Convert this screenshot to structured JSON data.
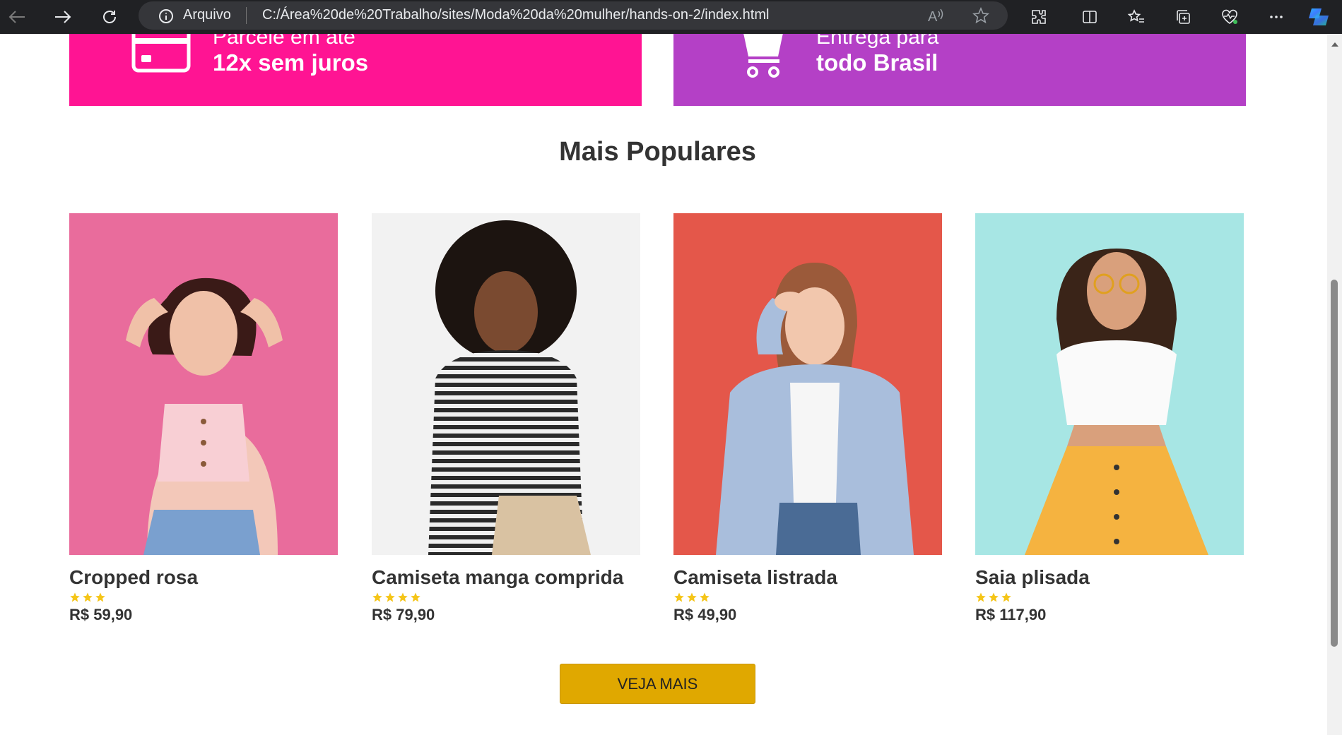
{
  "browser": {
    "site_label": "Arquivo",
    "url": "C:/Área%20de%20Trabalho/sites/Moda%20da%20mulher/hands-on-2/index.html",
    "read_aloud_label": "A"
  },
  "banners": [
    {
      "line1": "Parcele em até",
      "line2": "12x sem juros",
      "icon": "credit-card-icon",
      "color": "#ff1493"
    },
    {
      "line1": "Entrega para",
      "line2": "todo Brasil",
      "icon": "shopping-cart-icon",
      "color": "#b440c6"
    }
  ],
  "section": {
    "title": "Mais Populares"
  },
  "products": [
    {
      "name": "Cropped rosa",
      "rating": 3,
      "price": "R$ 59,90",
      "bg": "#e86a9a",
      "icon": "product-photo-pink-top"
    },
    {
      "name": "Camiseta manga comprida",
      "rating": 4,
      "price": "R$ 79,90",
      "bg": "#f1f1f1",
      "icon": "product-photo-striped-longsleeve"
    },
    {
      "name": "Camiseta listrada",
      "rating": 3,
      "price": "R$ 49,90",
      "bg": "#e35848",
      "icon": "product-photo-blue-shirt"
    },
    {
      "name": "Saia plisada",
      "rating": 3,
      "price": "R$ 117,90",
      "bg": "#a8e7e6",
      "icon": "product-photo-yellow-skirt"
    }
  ],
  "cta": {
    "label": "VEJA MAIS"
  },
  "colors": {
    "star": "#f5c518",
    "button": "#e0a800",
    "text": "#333333"
  }
}
